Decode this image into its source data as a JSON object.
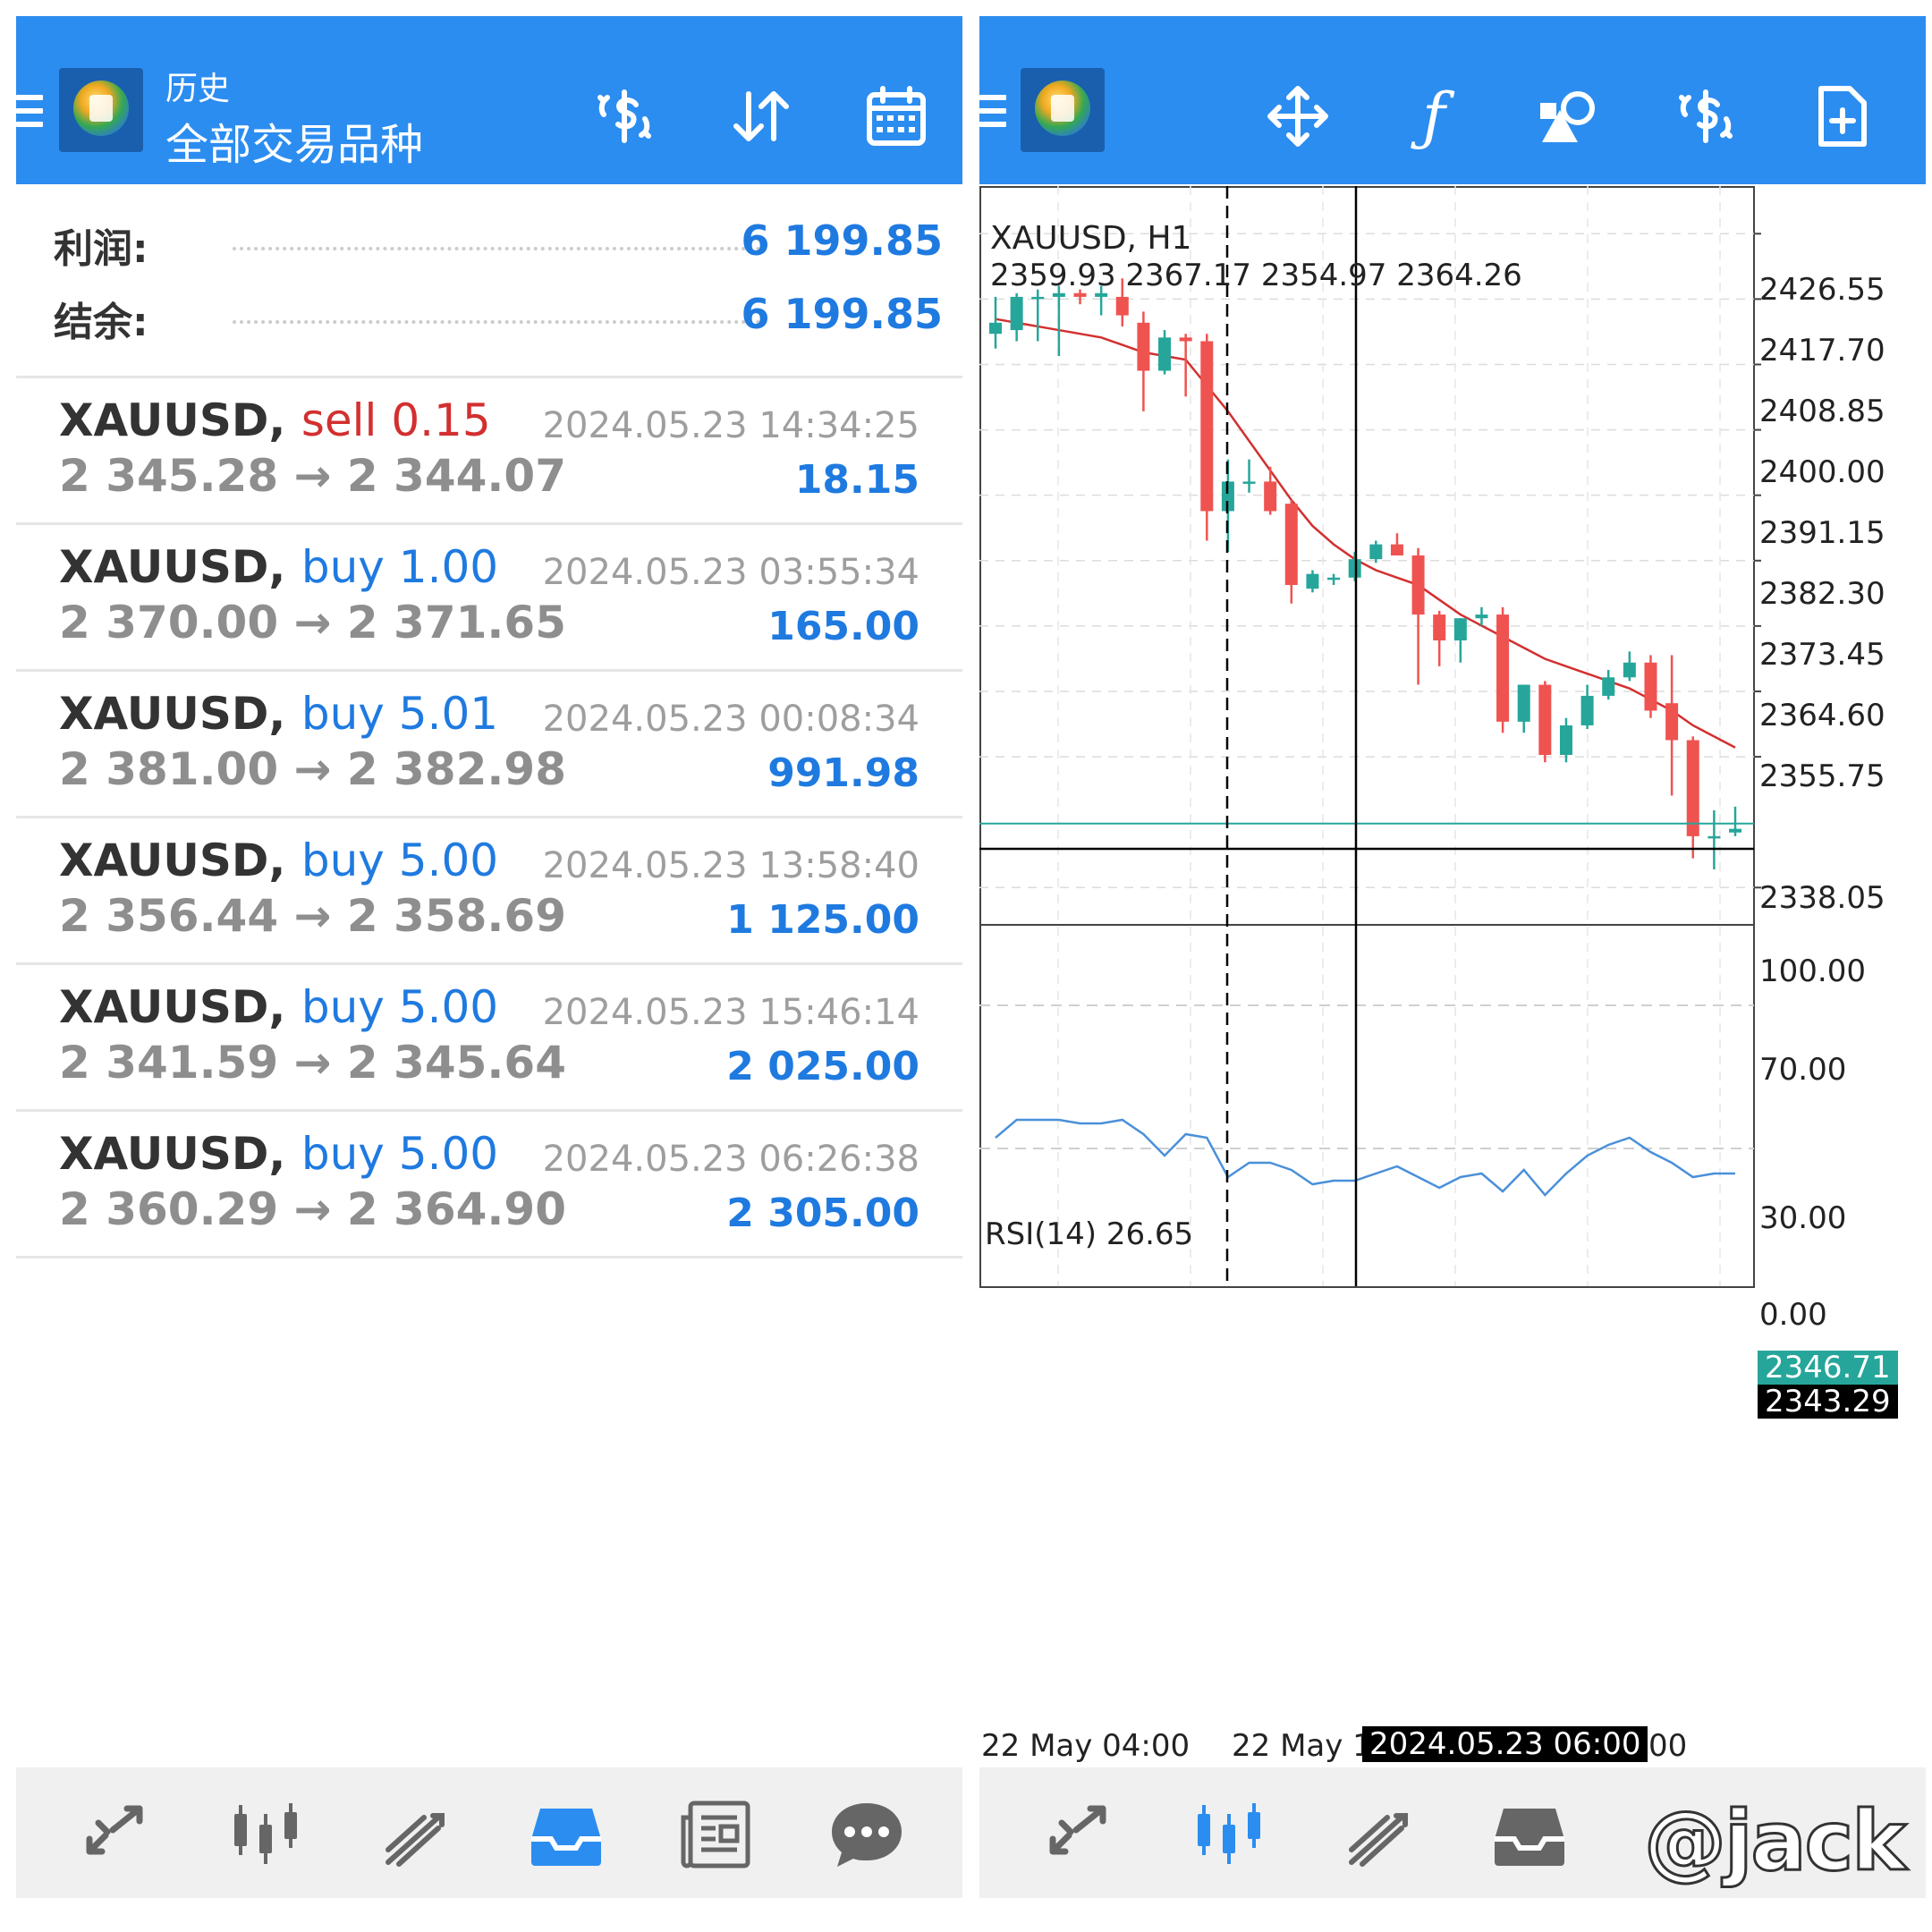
{
  "left": {
    "header": {
      "title_small": "历史",
      "title_big": "全部交易品种"
    },
    "summary": [
      {
        "label": "利润:",
        "value": "6 199.85"
      },
      {
        "label": "结余:",
        "value": "6 199.85"
      }
    ],
    "trades": [
      {
        "symbol": "XAUUSD,",
        "side": "sell 0.15",
        "side_color": "#d32f2f",
        "prices": "2 345.28 → 2 344.07",
        "time": "2024.05.23 14:34:25",
        "profit": "18.15"
      },
      {
        "symbol": "XAUUSD,",
        "side": "buy 1.00",
        "side_color": "#1f7ae0",
        "prices": "2 370.00 → 2 371.65",
        "time": "2024.05.23 03:55:34",
        "profit": "165.00"
      },
      {
        "symbol": "XAUUSD,",
        "side": "buy 5.01",
        "side_color": "#1f7ae0",
        "prices": "2 381.00 → 2 382.98",
        "time": "2024.05.23 00:08:34",
        "profit": "991.98"
      },
      {
        "symbol": "XAUUSD,",
        "side": "buy 5.00",
        "side_color": "#1f7ae0",
        "prices": "2 356.44 → 2 358.69",
        "time": "2024.05.23 13:58:40",
        "profit": "1 125.00"
      },
      {
        "symbol": "XAUUSD,",
        "side": "buy 5.00",
        "side_color": "#1f7ae0",
        "prices": "2 341.59 → 2 345.64",
        "time": "2024.05.23 15:46:14",
        "profit": "2 025.00"
      },
      {
        "symbol": "XAUUSD,",
        "side": "buy 5.00",
        "side_color": "#1f7ae0",
        "prices": "2 360.29 → 2 364.90",
        "time": "2024.05.23 06:26:38",
        "profit": "2 305.00"
      }
    ],
    "toolbar_icons": [
      "dollar-exchange-icon",
      "sort-arrows-icon",
      "calendar-icon"
    ],
    "nav": [
      "quotes-icon",
      "chart-icon",
      "trade-icon",
      "history-icon",
      "news-icon",
      "chat-icon"
    ],
    "nav_active": "history-icon"
  },
  "right": {
    "toolbar_icons": [
      "move-crosshair-icon",
      "function-icon",
      "objects-icon",
      "dollar-exchange-icon",
      "new-order-icon"
    ],
    "nav": [
      "quotes-icon",
      "chart-icon",
      "trade-icon",
      "history-icon"
    ],
    "nav_active": "chart-icon",
    "chart": {
      "symbol_tf": "XAUUSD, H1",
      "ohlc": "2359.93 2367.17 2354.97 2364.26",
      "price_ticks": [
        "2426.55",
        "2417.70",
        "2408.85",
        "2400.00",
        "2391.15",
        "2382.30",
        "2373.45",
        "2364.60",
        "2355.75",
        "2338.05"
      ],
      "bid_label": "2346.71",
      "crosshair_label": "2343.29",
      "rsi_title": "RSI(14) 26.65",
      "rsi_ticks": [
        "100.00",
        "70.00",
        "30.00",
        "0.00"
      ],
      "x_labels": [
        "22 May 04:00",
        "22 May 1",
        "00"
      ],
      "crosshair_time": "2024.05.23 06:00",
      "colors": {
        "bull": "#26a69a",
        "bear": "#ef5350",
        "ma": "#d32f2f",
        "rsi": "#4a90d9"
      }
    }
  },
  "watermark": "@jack",
  "chart_data": [
    {
      "type": "candlestick",
      "title": "XAUUSD, H1",
      "ylim": [
        2333,
        2433
      ],
      "candles": [
        {
          "o": 2413.0,
          "h": 2418.0,
          "l": 2411.0,
          "c": 2414.5
        },
        {
          "o": 2413.5,
          "h": 2418.5,
          "l": 2412.0,
          "c": 2418.0
        },
        {
          "o": 2418.0,
          "h": 2419.0,
          "l": 2412.0,
          "c": 2418.0
        },
        {
          "o": 2418.0,
          "h": 2419.5,
          "l": 2410.0,
          "c": 2418.5
        },
        {
          "o": 2418.5,
          "h": 2419.0,
          "l": 2417.0,
          "c": 2418.0
        },
        {
          "o": 2418.0,
          "h": 2419.5,
          "l": 2415.5,
          "c": 2418.5
        },
        {
          "o": 2418.0,
          "h": 2420.5,
          "l": 2414.0,
          "c": 2415.5
        },
        {
          "o": 2414.5,
          "h": 2416.0,
          "l": 2402.5,
          "c": 2408.0
        },
        {
          "o": 2408.0,
          "h": 2413.5,
          "l": 2407.5,
          "c": 2412.5
        },
        {
          "o": 2412.5,
          "h": 2413.0,
          "l": 2404.5,
          "c": 2412.0
        },
        {
          "o": 2412.0,
          "h": 2413.0,
          "l": 2385.0,
          "c": 2389.0
        },
        {
          "o": 2389.0,
          "h": 2396.0,
          "l": 2383.5,
          "c": 2393.0
        },
        {
          "o": 2393.0,
          "h": 2396.0,
          "l": 2391.5,
          "c": 2393.0
        },
        {
          "o": 2393.0,
          "h": 2395.0,
          "l": 2388.5,
          "c": 2389.0
        },
        {
          "o": 2390.0,
          "h": 2390.5,
          "l": 2376.5,
          "c": 2379.0
        },
        {
          "o": 2378.5,
          "h": 2381.0,
          "l": 2378.0,
          "c": 2380.5
        },
        {
          "o": 2380.0,
          "h": 2380.5,
          "l": 2379.0,
          "c": 2380.0
        },
        {
          "o": 2380.0,
          "h": 2383.5,
          "l": 2379.5,
          "c": 2382.5
        },
        {
          "o": 2382.5,
          "h": 2385.0,
          "l": 2382.0,
          "c": 2384.5
        },
        {
          "o": 2384.5,
          "h": 2386.0,
          "l": 2383.0,
          "c": 2383.0
        },
        {
          "o": 2383.0,
          "h": 2384.0,
          "l": 2365.5,
          "c": 2375.0
        },
        {
          "o": 2375.0,
          "h": 2375.5,
          "l": 2368.0,
          "c": 2371.5
        },
        {
          "o": 2371.5,
          "h": 2374.5,
          "l": 2368.5,
          "c": 2374.5
        },
        {
          "o": 2374.5,
          "h": 2376.0,
          "l": 2373.5,
          "c": 2375.0
        },
        {
          "o": 2375.0,
          "h": 2376.0,
          "l": 2359.0,
          "c": 2360.5
        },
        {
          "o": 2360.5,
          "h": 2365.5,
          "l": 2359.0,
          "c": 2365.5
        },
        {
          "o": 2365.5,
          "h": 2366.0,
          "l": 2355.0,
          "c": 2356.0
        },
        {
          "o": 2356.0,
          "h": 2361.0,
          "l": 2355.0,
          "c": 2360.0
        },
        {
          "o": 2360.0,
          "h": 2365.5,
          "l": 2359.5,
          "c": 2364.0
        },
        {
          "o": 2364.0,
          "h": 2367.5,
          "l": 2363.5,
          "c": 2366.5
        },
        {
          "o": 2366.5,
          "h": 2370.0,
          "l": 2366.0,
          "c": 2368.5
        },
        {
          "o": 2368.5,
          "h": 2369.5,
          "l": 2361.0,
          "c": 2362.0
        },
        {
          "o": 2363.0,
          "h": 2369.5,
          "l": 2350.5,
          "c": 2358.0
        },
        {
          "o": 2358.0,
          "h": 2358.5,
          "l": 2342.0,
          "c": 2345.0
        },
        {
          "o": 2345.0,
          "h": 2348.5,
          "l": 2340.5,
          "c": 2345.0
        },
        {
          "o": 2345.5,
          "h": 2349.0,
          "l": 2345.0,
          "c": 2346.0
        }
      ],
      "ma": [
        2415.0,
        2414.5,
        2414.0,
        2413.5,
        2413.0,
        2412.5,
        2411.5,
        2410.5,
        2410.0,
        2409.5,
        2406.0,
        2402.5,
        2398.5,
        2394.5,
        2390.5,
        2387.0,
        2384.5,
        2382.5,
        2381.0,
        2380.0,
        2379.0,
        2377.0,
        2375.0,
        2373.5,
        2372.0,
        2370.5,
        2369.0,
        2368.0,
        2367.0,
        2366.0,
        2365.0,
        2363.5,
        2362.0,
        2360.0,
        2358.5,
        2357.0
      ]
    },
    {
      "type": "line",
      "title": "RSI(14) 26.65",
      "ylim": [
        0,
        100
      ],
      "series": [
        {
          "values": [
            33,
            38,
            38,
            38,
            37,
            37,
            38,
            34,
            28,
            34,
            33,
            22,
            26,
            26,
            24,
            20,
            21,
            21,
            23,
            25,
            22,
            19,
            22,
            23,
            18,
            24,
            17,
            23,
            28,
            31,
            33,
            29,
            26,
            22,
            23,
            23
          ]
        }
      ]
    }
  ]
}
